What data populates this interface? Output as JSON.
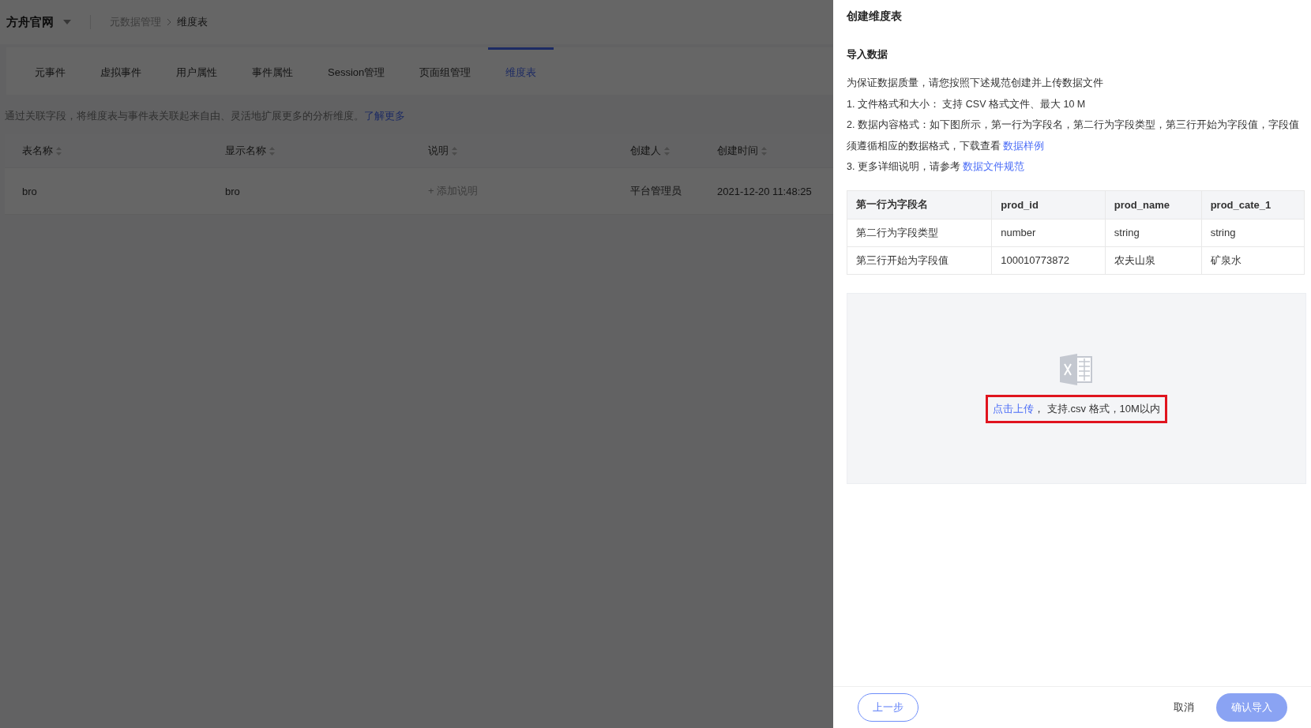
{
  "header": {
    "project": "方舟官网",
    "breadcrumb": [
      "元数据管理",
      "维度表"
    ]
  },
  "tabs": [
    {
      "label": "元事件",
      "selected": false
    },
    {
      "label": "虚拟事件",
      "selected": false
    },
    {
      "label": "用户属性",
      "selected": false
    },
    {
      "label": "事件属性",
      "selected": false
    },
    {
      "label": "Session管理",
      "selected": false
    },
    {
      "label": "页面组管理",
      "selected": false
    },
    {
      "label": "维度表",
      "selected": true
    }
  ],
  "description": {
    "text": "通过关联字段，将维度表与事件表关联起来自由、灵活地扩展更多的分析维度。",
    "link": "了解更多"
  },
  "table": {
    "columns": [
      {
        "label": "表名称"
      },
      {
        "label": "显示名称"
      },
      {
        "label": "说明"
      },
      {
        "label": "创建人"
      },
      {
        "label": "创建时间"
      }
    ],
    "rows": [
      {
        "name": "bro",
        "display_name": "bro",
        "note_action": "+ 添加说明",
        "creator": "平台管理员",
        "created": "2021-12-20 11:48:25"
      }
    ]
  },
  "drawer": {
    "title": "创建维度表",
    "section": "导入数据",
    "intro": "为保证数据质量，请您按照下述规范创建并上传数据文件",
    "rules": [
      {
        "text": "1. 文件格式和大小： 支持 CSV 格式文件、最大 10 M"
      },
      {
        "text": "2. 数据内容格式：如下图所示，第一行为字段名，第二行为字段类型，第三行开始为字段值，字段值须遵循相应的数据格式，下载查看 ",
        "link": "数据样例"
      },
      {
        "text": "3. 更多详细说明，请参考 ",
        "link": "数据文件规范"
      }
    ],
    "sample": {
      "header": [
        "第一行为字段名",
        "prod_id",
        "prod_name",
        "prod_cate_1"
      ],
      "rows": [
        [
          "第二行为字段类型",
          "number",
          "string",
          "string"
        ],
        [
          "第三行开始为字段值",
          "100010773872",
          "农夫山泉",
          "矿泉水"
        ]
      ]
    },
    "upload": {
      "link": "点击上传",
      "hint": "， 支持.csv 格式，10M以内"
    },
    "footer": {
      "back": "上一步",
      "cancel": "取消",
      "confirm": {
        "label": "确认导入",
        "disabled": true
      }
    }
  }
}
